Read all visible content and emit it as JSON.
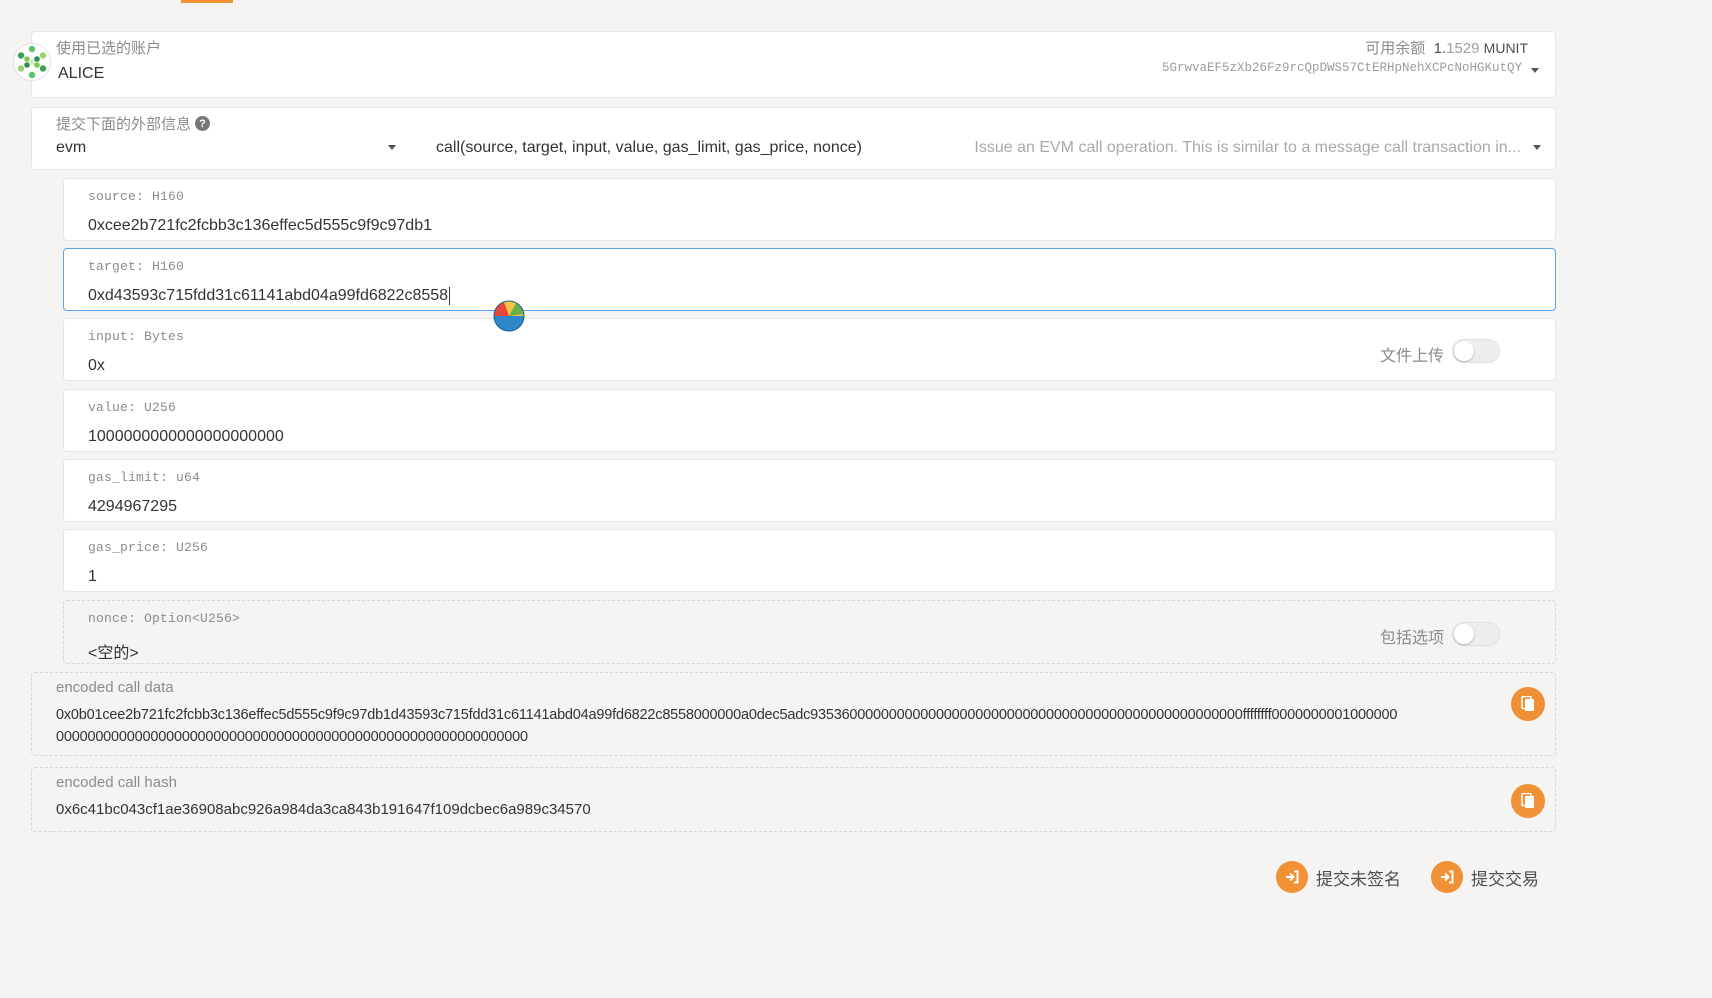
{
  "account": {
    "label": "使用已选的账户",
    "name": "ALICE",
    "balance_label": "可用余额",
    "balance_int": "1.",
    "balance_frac": "1529",
    "balance_unit": "MUNIT",
    "address": "5GrwvaEF5zXb26Fz9rcQpDWS57CtERHpNehXCPcNoHGKutQY"
  },
  "extrinsic": {
    "label": "提交下面的外部信息",
    "module": "evm",
    "method": "call(source, target, input, value, gas_limit, gas_price, nonce)",
    "description": "Issue an EVM call operation. This is similar to a message call transaction in..."
  },
  "params": {
    "source": {
      "label": "source: H160",
      "value": "0xcee2b721fc2fcbb3c136effec5d555c9f9c97db1"
    },
    "target": {
      "label": "target: H160",
      "value": "0xd43593c715fdd31c61141abd04a99fd6822c8558"
    },
    "input": {
      "label": "input: Bytes",
      "value": "0x",
      "toggle_label": "文件上传"
    },
    "value": {
      "label": "value: U256",
      "value": "1000000000000000000000"
    },
    "gas_limit": {
      "label": "gas_limit: u64",
      "value": "4294967295"
    },
    "gas_price": {
      "label": "gas_price: U256",
      "value": "1"
    },
    "nonce": {
      "label": "nonce: Option<U256>",
      "value": "<空的>",
      "toggle_label": "包括选项"
    }
  },
  "encoded": {
    "data_label": "encoded call data",
    "data_line1": "0x0b01cee2b721fc2fcbb3c136effec5d555c9f9c97db1d43593c715fdd31c61141abd04a99fd6822c8558000000a0dec5adc9353600000000000000000000000000000000000000000000000000ffffffff0000000001000000",
    "data_line2": "000000000000000000000000000000000000000000000000000000000000",
    "hash_label": "encoded call hash",
    "hash_value": "0x6c41bc043cf1ae36908abc926a984da3ca843b191647f109dcbec6a989c34570"
  },
  "actions": {
    "submit_unsigned": "提交未签名",
    "submit": "提交交易"
  },
  "colors": {
    "accent": "#f19135",
    "focus_border": "#58a6e8"
  }
}
